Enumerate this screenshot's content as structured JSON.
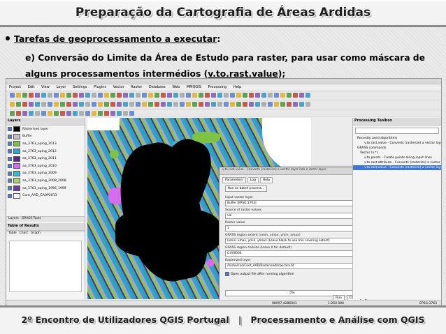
{
  "slide": {
    "title": "Preparação da Cartografia de Áreas Ardidas",
    "bullet_label": "Tarefas de geoprocessamento a executar",
    "bullet_colon": ":",
    "item_prefix": "e) Conversão do Limite da Área de Estudo para raster, para usar como máscara de alguns processamentos intermédios (",
    "item_link": "v.to.rast.value",
    "item_suffix": ");",
    "footer_left": "2º Encontro de Utilizadores QGIS Portugal",
    "footer_sep": "|",
    "footer_right": "Processamento e Análise com QGIS"
  },
  "qgis": {
    "menu": [
      "Project",
      "Edit",
      "View",
      "Layer",
      "Settings",
      "Plugins",
      "Vector",
      "Raster",
      "Database",
      "Web",
      "MMQGIS",
      "Processing",
      "Help"
    ],
    "layers_panel_title": "Layers",
    "layers": [
      {
        "name": "Rasterised layer",
        "color": "#000000",
        "checked": true
      },
      {
        "name": "Buffer",
        "color": "#c0c0c0",
        "checked": true
      },
      {
        "name": "aa_3763_aping_2013",
        "color": "#7fc241",
        "checked": true
      },
      {
        "name": "aa_3763_aping_2012",
        "color": "#2fa6c9",
        "checked": true
      },
      {
        "name": "aa_3763_aping_2011",
        "color": "#5b2c85",
        "checked": true
      },
      {
        "name": "aa_3763_aping_2010",
        "color": "#d86bf0",
        "checked": true
      },
      {
        "name": "aa_3763_aping_2009",
        "color": "#3fb6d6",
        "checked": true
      },
      {
        "name": "aa_3763_aping_2008_2008",
        "color": "#a3d46b",
        "checked": true
      },
      {
        "name": "aa_3763_aping_1996_1999",
        "color": "#6d3c98",
        "checked": true
      },
      {
        "name": "Cont_AAD_CAOP2013",
        "color": "#ffffff",
        "checked": true
      }
    ],
    "layer_tabs": [
      "Layers",
      "GRASS Tools"
    ],
    "bottom_panel_title": "Table of Results",
    "bottom_panel_tabs": [
      "Table",
      "Chart",
      "Graph"
    ],
    "dialog": {
      "title": "v.to.rast.value - Converts (rasterize) a vector layer into a raster layer",
      "tabs": [
        "Parameters",
        "Log",
        "Help"
      ],
      "run_as_batch": "Run as batch process...",
      "fields": [
        {
          "label": "Input vector layer",
          "value": "Buffer [EPSG:3763]"
        },
        {
          "label": "Source of raster values",
          "value": "val"
        },
        {
          "label": "Raster value",
          "value": "1"
        },
        {
          "label": "GRASS region extent (xmin, xmax, ymin, ymax)",
          "value": "(xmin, xmax, ymin, ymax) [Leave blank to use min covering extent]"
        },
        {
          "label": "GRASS region cellsize (leave 0 for default)",
          "value": "0.000000"
        },
        {
          "label": "Rasterized layer",
          "value": "/home/ciro/Cont_AAD/Rasterised/mascara.tif"
        }
      ],
      "open_output": "Open output file after running algorithm",
      "progress": "0%",
      "run_button": "Run",
      "close_button": "Close"
    },
    "toolbox": {
      "title": "Processing Toolbox",
      "items": [
        "Recently used algorithms",
        "v.to.rast.value - Converts (rasterize) a vector layer",
        "GRASS commands",
        "Vector (v.*)",
        "v.to.points - Create points along input lines",
        "v.to.rast.attribute - Converts (rasterize) a vector layer",
        "v.to.rast.value - Converts (rasterize) a vector layer into a raster"
      ],
      "selected_index": 6
    },
    "status_coord": "98997,4286041",
    "status_scale": "1:250 000",
    "status_crs": "EPSG:3763"
  }
}
